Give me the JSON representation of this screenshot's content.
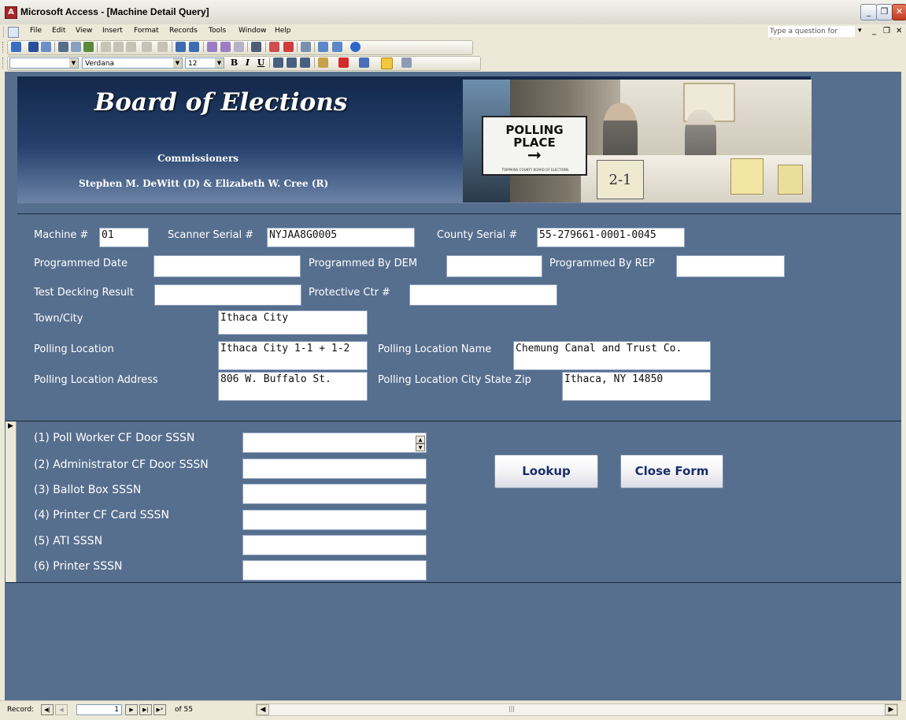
{
  "window": {
    "title": "Microsoft Access - [Machine Detail Query]"
  },
  "menu": {
    "items": [
      "File",
      "Edit",
      "View",
      "Insert",
      "Format",
      "Records",
      "Tools",
      "Window",
      "Help"
    ],
    "help_placeholder": "Type a question for help"
  },
  "toolbar": {
    "object_combo": "",
    "font_name": "Verdana",
    "font_size": "12",
    "bold": "B",
    "italic": "I",
    "underline": "U"
  },
  "header": {
    "title": "Board of Elections",
    "commissioners_label": "Commissioners",
    "commissioners_names": "Stephen M. DeWitt (D) & Elizabeth W. Cree (R)",
    "photo": {
      "sign_line1": "POLLING",
      "sign_line2": "PLACE",
      "sign_footer": "TOMPKINS COUNTY BOARD OF ELECTIONS",
      "district": "2-1"
    }
  },
  "machine": {
    "machine_no": {
      "label": "Machine #",
      "value": "01"
    },
    "scanner_serial": {
      "label": "Scanner Serial #",
      "value": "NYJAA8G0005"
    },
    "county_serial": {
      "label": "County Serial #",
      "value": "55-279661-0001-0045"
    },
    "programmed_date": {
      "label": "Programmed Date",
      "value": ""
    },
    "programmed_by_dem": {
      "label": "Programmed By DEM",
      "value": ""
    },
    "programmed_by_rep": {
      "label": "Programmed By REP",
      "value": ""
    },
    "test_decking_result": {
      "label": "Test Decking Result",
      "value": ""
    },
    "protective_ctr": {
      "label": "Protective Ctr #",
      "value": ""
    },
    "town_city": {
      "label": "Town/City",
      "value": "Ithaca City"
    },
    "polling_location": {
      "label": "Polling Location",
      "value": "Ithaca City 1-1 + 1-2"
    },
    "polling_location_name": {
      "label": "Polling Location Name",
      "value": "Chemung Canal and Trust Co."
    },
    "polling_location_address": {
      "label": "Polling Location Address",
      "value": "806 W. Buffalo St."
    },
    "polling_location_csz": {
      "label": "Polling Location City State Zip",
      "value": "Ithaca, NY 14850"
    }
  },
  "seals": {
    "rows": [
      {
        "label": "(1) Poll Worker CF Door SSSN",
        "value": ""
      },
      {
        "label": "(2) Administrator CF Door SSSN",
        "value": ""
      },
      {
        "label": "(3) Ballot Box SSSN",
        "value": ""
      },
      {
        "label": "(4) Printer CF Card SSSN",
        "value": ""
      },
      {
        "label": "(5) ATI SSSN",
        "value": ""
      },
      {
        "label": "(6) Printer SSSN",
        "value": ""
      }
    ],
    "lookup_label": "Lookup",
    "close_label": "Close Form"
  },
  "status": {
    "record_label": "Record:",
    "current": "1",
    "of_text": "of 55"
  },
  "colors": {
    "form_background": "#576f8e",
    "banner": "#1c3358",
    "button_text": "#1a2e6c"
  }
}
